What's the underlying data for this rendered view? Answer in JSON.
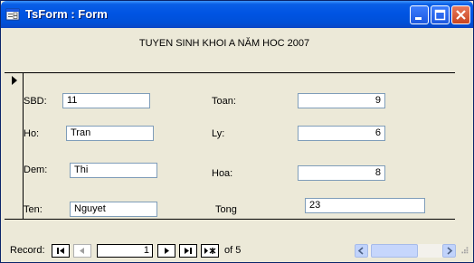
{
  "window": {
    "title": "TsForm : Form",
    "icons": {
      "app": "form-icon",
      "minimize": "minimize-icon",
      "maximize": "maximize-icon",
      "close": "close-icon"
    }
  },
  "form": {
    "heading": "TUYEN SINH KHOI A NĂM HOC 2007",
    "fields": {
      "sbd": {
        "label": "SBD:",
        "value": "11"
      },
      "ho": {
        "label": "Ho:",
        "value": "Tran"
      },
      "dem": {
        "label": "Dem:",
        "value": "Thi"
      },
      "ten": {
        "label": "Ten:",
        "value": "Nguyet"
      },
      "toan": {
        "label": "Toan:",
        "value": "9"
      },
      "ly": {
        "label": "Ly:",
        "value": "6"
      },
      "hoa": {
        "label": "Hoa:",
        "value": "8"
      },
      "tong": {
        "label": "Tong",
        "value": "23"
      }
    }
  },
  "navigation": {
    "label": "Record:",
    "current_record": "1",
    "of_text": "of 5",
    "icons": {
      "first": "first-record-icon",
      "prev": "previous-record-icon",
      "next": "next-record-icon",
      "last": "last-record-icon",
      "new": "new-record-icon"
    }
  }
}
